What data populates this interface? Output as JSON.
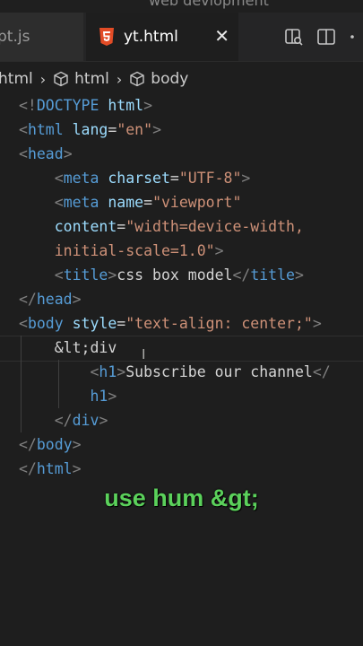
{
  "window": {
    "title": "web devlopment"
  },
  "tabs": [
    {
      "label": "pt.js",
      "active": false
    },
    {
      "label": "yt.html",
      "active": true
    }
  ],
  "breadcrumb": [
    "html",
    "html",
    "body"
  ],
  "editor": {
    "lines": [
      [
        [
          "tag",
          "<!"
        ],
        [
          "tn",
          "DOCTYPE"
        ],
        [
          "tx",
          " "
        ],
        [
          "an",
          "html"
        ],
        [
          "tag",
          ">"
        ]
      ],
      [
        [
          "tag",
          "<"
        ],
        [
          "tn",
          "html"
        ],
        [
          "tx",
          " "
        ],
        [
          "an",
          "lang"
        ],
        [
          "tx",
          "="
        ],
        [
          "av",
          "\"en\""
        ],
        [
          "tag",
          ">"
        ]
      ],
      [
        [
          "tag",
          "<"
        ],
        [
          "tn",
          "head"
        ],
        [
          "tag",
          ">"
        ]
      ],
      [
        [
          "tx",
          "    "
        ],
        [
          "tag",
          "<"
        ],
        [
          "tn",
          "meta"
        ],
        [
          "tx",
          " "
        ],
        [
          "an",
          "charset"
        ],
        [
          "tx",
          "="
        ],
        [
          "av",
          "\"UTF-8\""
        ],
        [
          "tag",
          ">"
        ]
      ],
      [
        [
          "tx",
          "    "
        ],
        [
          "tag",
          "<"
        ],
        [
          "tn",
          "meta"
        ],
        [
          "tx",
          " "
        ],
        [
          "an",
          "name"
        ],
        [
          "tx",
          "="
        ],
        [
          "av",
          "\"viewport\""
        ]
      ],
      [
        [
          "tx",
          "    "
        ],
        [
          "an",
          "content"
        ],
        [
          "tx",
          "="
        ],
        [
          "av",
          "\"width=device-width,"
        ]
      ],
      [
        [
          "tx",
          "    "
        ],
        [
          "av",
          "initial-scale=1.0\""
        ],
        [
          "tag",
          ">"
        ]
      ],
      [
        [
          "tx",
          "    "
        ],
        [
          "tag",
          "<"
        ],
        [
          "tn",
          "title"
        ],
        [
          "tag",
          ">"
        ],
        [
          "tx",
          "css box model"
        ],
        [
          "tag",
          "</"
        ],
        [
          "tn",
          "title"
        ],
        [
          "tag",
          ">"
        ]
      ],
      [
        [
          "tag",
          "</"
        ],
        [
          "tn",
          "head"
        ],
        [
          "tag",
          ">"
        ]
      ],
      [
        [
          "tag",
          "<"
        ],
        [
          "tn",
          "body"
        ],
        [
          "tx",
          " "
        ],
        [
          "an",
          "style"
        ],
        [
          "tx",
          "="
        ],
        [
          "av",
          "\"text-align: center;\""
        ],
        [
          "tag",
          ">"
        ]
      ],
      [
        [
          "tx",
          "    &lt;div"
        ]
      ],
      [
        [
          "tx",
          "        "
        ],
        [
          "tag",
          "<"
        ],
        [
          "tn",
          "h1"
        ],
        [
          "tag",
          ">"
        ],
        [
          "tx",
          "Subscribe our channel"
        ],
        [
          "tag",
          "</"
        ]
      ],
      [
        [
          "tx",
          "        "
        ],
        [
          "tn",
          "h1"
        ],
        [
          "tag",
          ">"
        ]
      ],
      [
        [
          "tx",
          "    "
        ],
        [
          "tag",
          "</"
        ],
        [
          "tn",
          "div"
        ],
        [
          "tag",
          ">"
        ]
      ],
      [
        [
          "tag",
          "</"
        ],
        [
          "tn",
          "body"
        ],
        [
          "tag",
          ">"
        ]
      ],
      [
        [
          "tag",
          "</"
        ],
        [
          "tn",
          "html"
        ],
        [
          "tag",
          ">"
        ]
      ]
    ]
  },
  "caption": "use hum &gt;",
  "colors": {
    "background": "#1e1e1e",
    "tag_bracket": "#808080",
    "tag_name": "#569cd6",
    "attr_name": "#9cdcfe",
    "attr_value": "#ce9178",
    "caption": "#5bd15b"
  }
}
